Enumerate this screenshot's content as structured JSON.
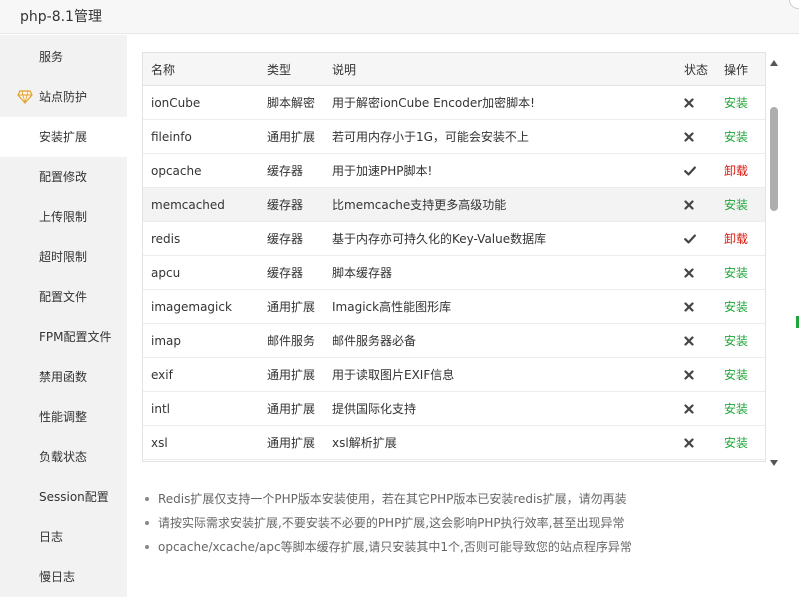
{
  "window": {
    "title": "php-8.1管理"
  },
  "sidebar": {
    "items": [
      {
        "label": "服务",
        "icon": ""
      },
      {
        "label": "站点防护",
        "icon": "diamond-badge-icon"
      },
      {
        "label": "安装扩展",
        "active": true
      },
      {
        "label": "配置修改"
      },
      {
        "label": "上传限制"
      },
      {
        "label": "超时限制"
      },
      {
        "label": "配置文件"
      },
      {
        "label": "FPM配置文件"
      },
      {
        "label": "禁用函数"
      },
      {
        "label": "性能调整"
      },
      {
        "label": "负载状态"
      },
      {
        "label": "Session配置"
      },
      {
        "label": "日志"
      },
      {
        "label": "慢日志"
      }
    ]
  },
  "table": {
    "headers": {
      "name": "名称",
      "type": "类型",
      "desc": "说明",
      "state": "状态",
      "op": "操作"
    },
    "rows": [
      {
        "name": "ionCube",
        "type": "脚本解密",
        "desc": "用于解密ionCube Encoder加密脚本!",
        "state": "not-installed",
        "op": "安装"
      },
      {
        "name": "fileinfo",
        "type": "通用扩展",
        "desc": "若可用内存小于1G，可能会安装不上",
        "state": "not-installed",
        "op": "安装"
      },
      {
        "name": "opcache",
        "type": "缓存器",
        "desc": "用于加速PHP脚本!",
        "state": "installed",
        "op": "卸载"
      },
      {
        "name": "memcached",
        "type": "缓存器",
        "desc": "比memcache支持更多高级功能",
        "state": "not-installed",
        "op": "安装"
      },
      {
        "name": "redis",
        "type": "缓存器",
        "desc": "基于内存亦可持久化的Key-Value数据库",
        "state": "installed",
        "op": "卸载"
      },
      {
        "name": "apcu",
        "type": "缓存器",
        "desc": "脚本缓存器",
        "state": "not-installed",
        "op": "安装"
      },
      {
        "name": "imagemagick",
        "type": "通用扩展",
        "desc": "Imagick高性能图形库",
        "state": "not-installed",
        "op": "安装"
      },
      {
        "name": "imap",
        "type": "邮件服务",
        "desc": "邮件服务器必备",
        "state": "not-installed",
        "op": "安装"
      },
      {
        "name": "exif",
        "type": "通用扩展",
        "desc": "用于读取图片EXIF信息",
        "state": "not-installed",
        "op": "安装"
      },
      {
        "name": "intl",
        "type": "通用扩展",
        "desc": "提供国际化支持",
        "state": "not-installed",
        "op": "安装"
      },
      {
        "name": "xsl",
        "type": "通用扩展",
        "desc": "xsl解析扩展",
        "state": "not-installed",
        "op": "安装"
      }
    ]
  },
  "notes": [
    "Redis扩展仅支持一个PHP版本安装使用，若在其它PHP版本已安装redis扩展，请勿再装",
    "请按实际需求安装扩展,不要安装不必要的PHP扩展,这会影响PHP执行效率,甚至出现异常",
    "opcache/xcache/apc等脚本缓存扩展,请只安装其中1个,否则可能导致您的站点程序异常"
  ],
  "colors": {
    "install": "#20a53a",
    "uninstall": "#d9150b",
    "sidebar_bg": "#f2f2f2",
    "header_bg": "#f6f6f6"
  }
}
